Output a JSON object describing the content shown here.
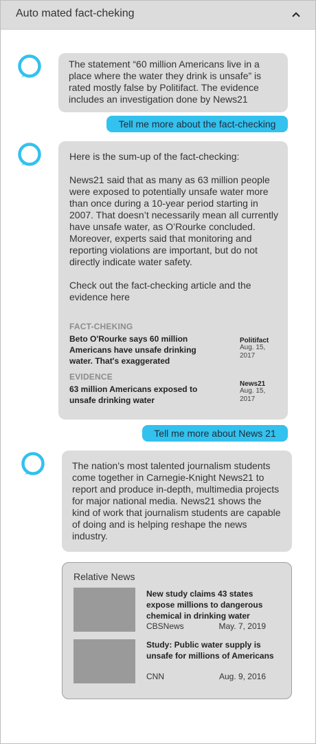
{
  "header": {
    "title": "Auto mated fact-cheking",
    "collapse_icon": "chevron-up-icon"
  },
  "assistant": {
    "avatar_icon": "assistant-ring-icon",
    "accent_color": "#33c1ee"
  },
  "messages": {
    "bot1": {
      "text": "The statement “60 million Americans live in a place where the water they drink is unsafe” is rated mostly false by Politifact. The evidence includes an investigation done by News21"
    },
    "user1": {
      "text": "Tell me more about the fact-checking"
    },
    "bot2": {
      "intro": "Here is the sum-up of the fact-checking:",
      "body": "News21 said that as many as 63 million people were exposed to potentially unsafe water more than once during a 10-year period starting in 2007. That doesn’t necessarily mean all currently have unsafe water, as O’Rourke concluded. Moreover, experts said that monitoring and reporting violations are important, but do not directly indicate water safety.",
      "cta": "Check out the fact-checking article and the evidence here",
      "factcheck": {
        "label": "FACT-CHEKING",
        "title": "Beto O'Rourke says 60 million Americans have unsafe drinking water. That's exaggerated",
        "source": "Politifact",
        "date": "Aug. 15, 2017"
      },
      "evidence": {
        "label": "EVIDENCE",
        "title": "63 million Americans exposed to unsafe drinking water",
        "source": "News21",
        "date": "Aug. 15, 2017"
      }
    },
    "user2": {
      "text": "Tell me more about News 21"
    },
    "bot3": {
      "text": "The nation’s most talented journalism students come together in Carnegie-Knight News21 to report and produce in-depth, multimedia projects for major national media. News21 shows the kind of work that journalism students are capable of doing and is helping reshape the news industry."
    }
  },
  "related": {
    "title": "Relative News",
    "items": [
      {
        "title": "New study claims 43 states expose millions to dangerous chemical in drinking water",
        "source": "CBSNews",
        "date": "May. 7, 2019"
      },
      {
        "title": "Study: Public water supply is unsafe for millions of Americans",
        "source": "CNN",
        "date": "Aug. 9, 2016"
      }
    ]
  }
}
